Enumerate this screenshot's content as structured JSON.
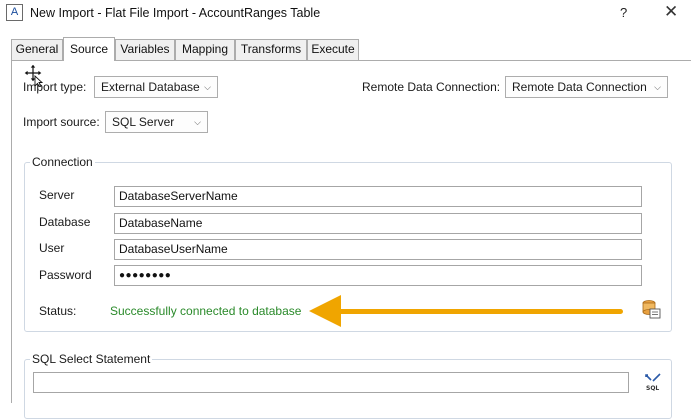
{
  "window": {
    "app_icon_letter": "A",
    "title": "New Import - Flat File Import - AccountRanges Table",
    "help_label": "?",
    "close_label": "✕"
  },
  "tabs": [
    {
      "label": "General"
    },
    {
      "label": "Source"
    },
    {
      "label": "Variables"
    },
    {
      "label": "Mapping"
    },
    {
      "label": "Transforms"
    },
    {
      "label": "Execute"
    }
  ],
  "active_tab": "Source",
  "source": {
    "import_type_label": "Import type:",
    "import_type_value": "External Database",
    "remote_label": "Remote Data Connection:",
    "remote_value": "Remote Data Connection",
    "import_source_label": "Import source:",
    "import_source_value": "SQL Server"
  },
  "connection": {
    "legend": "Connection",
    "server_label": "Server",
    "server_value": "DatabaseServerName",
    "database_label": "Database",
    "database_value": "DatabaseName",
    "user_label": "User",
    "user_value": "DatabaseUserName",
    "password_label": "Password",
    "password_value": "●●●●●●●●",
    "status_label": "Status:",
    "status_value": "Successfully connected to database"
  },
  "sql": {
    "legend": "SQL Select Statement",
    "value": ""
  },
  "colors": {
    "accent_arrow": "#f0a500",
    "status_success": "#2a8a2a"
  },
  "icons": {
    "dropdown": "chevron-down-icon",
    "test_connection": "test-connection-icon",
    "sql_query": "sql-query-icon",
    "cursor": "move-cursor-icon"
  }
}
